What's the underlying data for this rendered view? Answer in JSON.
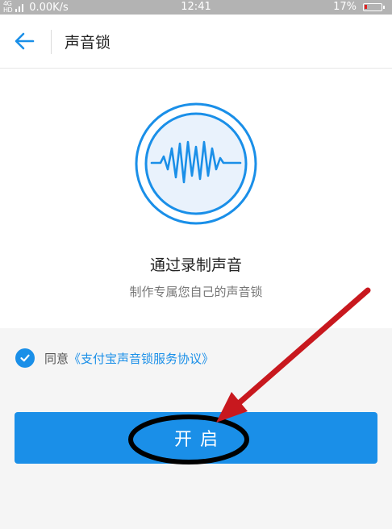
{
  "status_bar": {
    "signal_top": "4G",
    "signal_bottom": "HD",
    "net_speed": "0.00K/s",
    "time": "12:41",
    "battery_pct": "17%",
    "battery_level": 0.17
  },
  "header": {
    "title": "声音锁"
  },
  "hero": {
    "title": "通过录制声音",
    "subtitle": "制作专属您自己的声音锁"
  },
  "agreement": {
    "prefix": "同意",
    "link": "《支付宝声音锁服务协议》",
    "checked": true
  },
  "actions": {
    "enable_label": "开启"
  },
  "colors": {
    "accent": "#1a8fe8",
    "emblem_fill": "#e9f2fc",
    "annotation_arrow": "#c8181e",
    "annotation_ellipse": "#000000"
  },
  "icons": {
    "back": "arrow-left-icon",
    "check": "check-icon",
    "emblem": "sound-wave-icon"
  }
}
